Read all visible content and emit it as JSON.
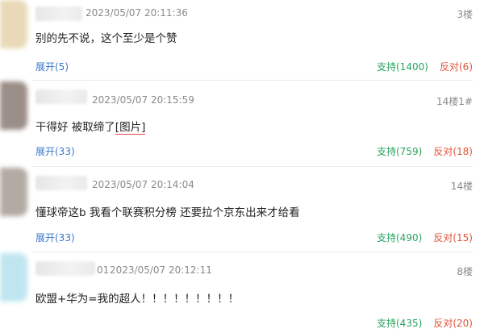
{
  "comments": [
    {
      "time": "2023/05/07 20:11:36",
      "floor": "3楼",
      "content": "别的先不说，这个至少是个赞",
      "expand": "展开(5)",
      "support": "支持(1400)",
      "oppose": "反对(6)"
    },
    {
      "time": "2023/05/07 20:15:59",
      "floor": "14楼1#",
      "content": "干得好 被取缔了",
      "image_tag": "[图片]",
      "expand": "展开(33)",
      "support": "支持(759)",
      "oppose": "反对(18)"
    },
    {
      "time": "2023/05/07 20:14:04",
      "floor": "14楼",
      "content": "懂球帝这b 我看个联赛积分榜 还要拉个京东出来才给看",
      "expand": "展开(33)",
      "support": "支持(490)",
      "oppose": "反对(15)"
    },
    {
      "name_fragment": "01",
      "time": "2023/05/07 20:12:11",
      "floor": "8楼",
      "content": "欧盟+华为=我的超人！！！！！！！！！",
      "support": "支持(435)",
      "oppose": "反对(20)"
    }
  ],
  "colors": {
    "link_blue": "#3a78c9",
    "support_green": "#27a45f",
    "oppose_red": "#e2533a",
    "meta_gray": "#8a8a8a"
  }
}
